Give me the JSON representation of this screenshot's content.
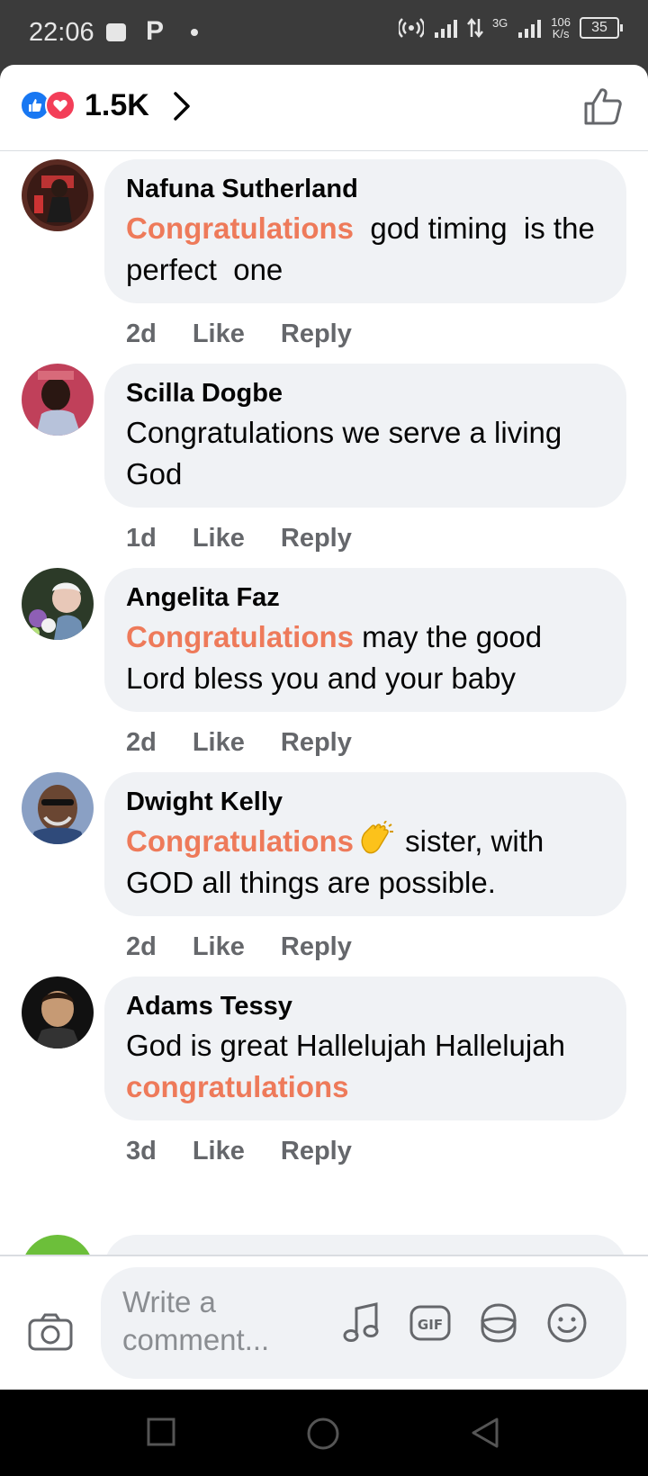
{
  "status_bar": {
    "time": "22:06",
    "network": "3G",
    "speed_value": "106",
    "speed_unit": "K/s",
    "battery": "35"
  },
  "header": {
    "reaction_count": "1.5K"
  },
  "colors": {
    "like_blue": "#1877f2",
    "love_red": "#f33e58",
    "highlight": "#ee7a5a",
    "bubble_bg": "#f0f2f5",
    "meta_gray": "#65676b"
  },
  "comments": [
    {
      "name": "Nafuna Sutherland",
      "highlight": "Congratulations",
      "text": "  god timing  is the perfect  one",
      "time": "2d",
      "like": "Like",
      "reply": "Reply"
    },
    {
      "name": "Scilla Dogbe",
      "text": "Congratulations we serve a living God",
      "time": "1d",
      "like": "Like",
      "reply": "Reply"
    },
    {
      "name": "Angelita Faz",
      "highlight": "Congratulations",
      "text": " may the good Lord bless you and your baby",
      "time": "2d",
      "like": "Like",
      "reply": "Reply"
    },
    {
      "name": "Dwight Kelly",
      "highlight": "Congratulations",
      "text": " sister, with GOD all things are possible.",
      "time": "2d",
      "like": "Like",
      "reply": "Reply"
    },
    {
      "name": "Adams Tessy",
      "text": "God is great Hallelujah Hallelujah ",
      "highlight": "congratulations",
      "time": "3d",
      "like": "Like",
      "reply": "Reply"
    }
  ],
  "composer": {
    "placeholder": "Write a comment..."
  },
  "icons": {
    "camera": "camera-icon",
    "music": "music-note-icon",
    "gif": "gif-icon",
    "sticker": "sticker-icon",
    "emoji": "emoji-icon"
  }
}
